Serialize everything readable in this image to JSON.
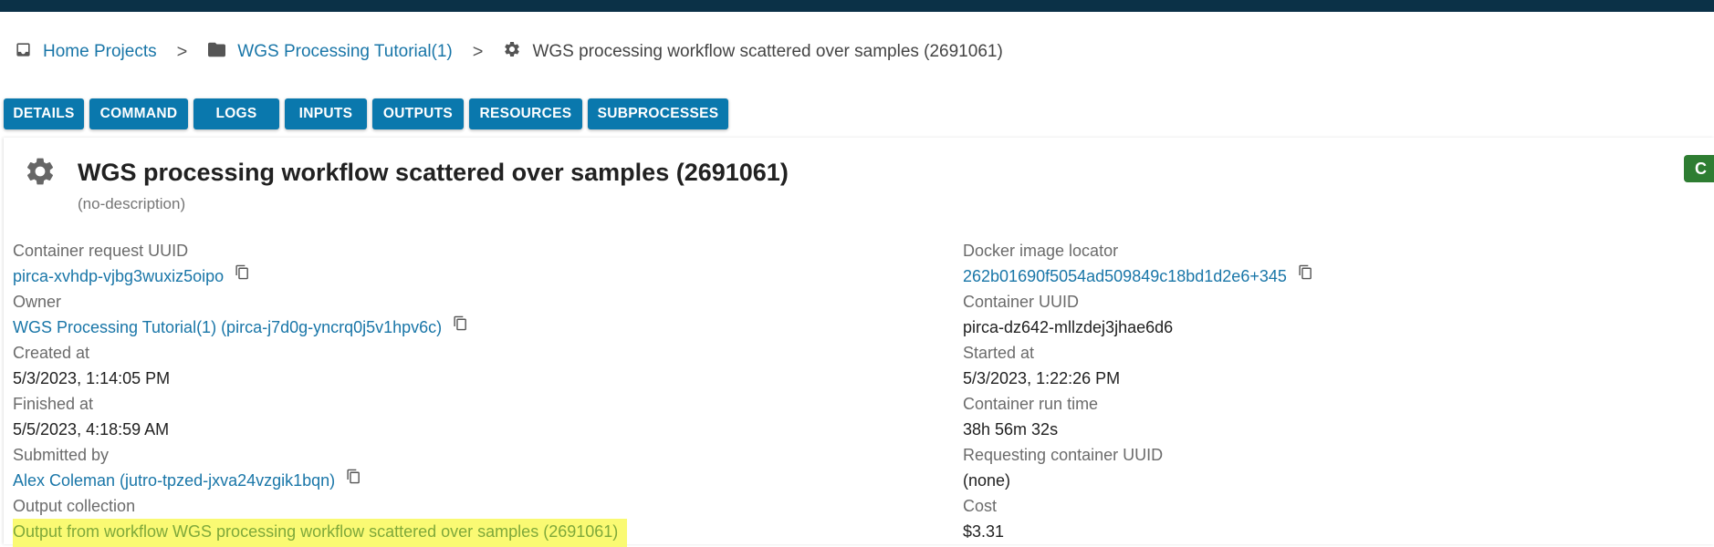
{
  "breadcrumbs": {
    "home": "Home Projects",
    "project": "WGS Processing Tutorial(1)",
    "current": "WGS processing workflow scattered over samples (2691061)"
  },
  "tabs": [
    "DETAILS",
    "COMMAND",
    "LOGS",
    "INPUTS",
    "OUTPUTS",
    "RESOURCES",
    "SUBPROCESSES"
  ],
  "process": {
    "title": "WGS processing workflow scattered over samples (2691061)",
    "description": "(no-description)",
    "status_visible": "C"
  },
  "details_left": {
    "container_request_uuid_label": "Container request UUID",
    "container_request_uuid": "pirca-xvhdp-vjbg3wuxiz5oipo",
    "owner_label": "Owner",
    "owner": "WGS Processing Tutorial(1) (pirca-j7d0g-yncrq0j5v1hpv6c)",
    "created_at_label": "Created at",
    "created_at": "5/3/2023, 1:14:05 PM",
    "finished_at_label": "Finished at",
    "finished_at": "5/5/2023, 4:18:59 AM",
    "submitted_by_label": "Submitted by",
    "submitted_by": "Alex Coleman (jutro-tpzed-jxva24vzgik1bqn)",
    "output_collection_label": "Output collection",
    "output_collection": "Output from workflow WGS processing workflow scattered over samples (2691061)"
  },
  "details_right": {
    "docker_image_label": "Docker image locator",
    "docker_image": "262b01690f5054ad509849c18bd1d2e6+345",
    "container_uuid_label": "Container UUID",
    "container_uuid": "pirca-dz642-mllzdej3jhae6d6",
    "started_at_label": "Started at",
    "started_at": "5/3/2023, 1:22:26 PM",
    "run_time_label": "Container run time",
    "run_time": "38h 56m 32s",
    "requesting_uuid_label": "Requesting container UUID",
    "requesting_uuid": "(none)",
    "cost_label": "Cost",
    "cost": "$3.31"
  },
  "colors": {
    "topbar": "#0b3147",
    "tab_bg": "#0a78ad",
    "link": "#1976a8",
    "status_chip": "#2e7d32",
    "highlight": "#fafa73"
  },
  "icons": {
    "home": "inbox-icon",
    "project": "folder-icon",
    "process": "gear-icon",
    "copy": "copy-icon"
  }
}
